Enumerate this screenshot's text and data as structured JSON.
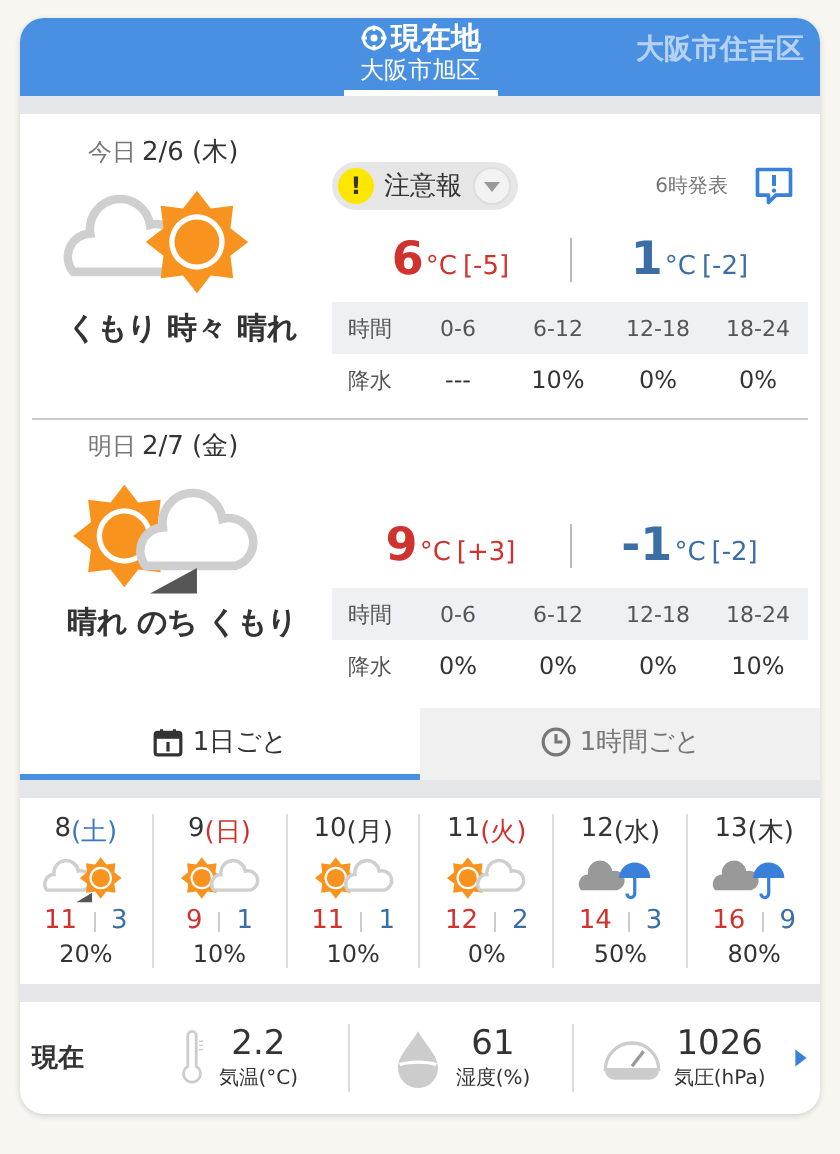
{
  "header": {
    "current": {
      "title": "現在地",
      "subtitle": "大阪市旭区",
      "selected": true
    },
    "other": {
      "title": "大阪市住吉区",
      "selected": false
    }
  },
  "days": [
    {
      "label": "今日",
      "date": "2/6 (木)",
      "kind": "cloudsun",
      "weather": "くもり 時々 晴れ",
      "high": {
        "value": "6",
        "unit": "°C",
        "diff": "[-5]"
      },
      "low": {
        "value": "1",
        "unit": "°C",
        "diff": "[-2]"
      },
      "times": [
        "時間",
        "0-6",
        "6-12",
        "12-18",
        "18-24"
      ],
      "rain": [
        "降水",
        "---",
        "10%",
        "0%",
        "0%"
      ]
    },
    {
      "label": "明日",
      "date": "2/7 (金)",
      "kind": "sunlatercloud",
      "weather": "晴れ のち くもり",
      "high": {
        "value": "9",
        "unit": "°C",
        "diff": "[+3]"
      },
      "low": {
        "value": "-1",
        "unit": "°C",
        "diff": "[-2]"
      },
      "times": [
        "時間",
        "0-6",
        "6-12",
        "12-18",
        "18-24"
      ],
      "rain": [
        "降水",
        "0%",
        "0%",
        "0%",
        "10%"
      ]
    }
  ],
  "alert": {
    "mark": "!",
    "label": "注意報",
    "issued": "6時発表"
  },
  "tabs": [
    {
      "label": "1日ごと",
      "selected": true
    },
    {
      "label": "1時間ごと",
      "selected": false
    }
  ],
  "week": [
    {
      "day": "8",
      "dow": "(土)",
      "color": "#3a78c2",
      "kind": "cloudlatersun",
      "high": "11",
      "low": "3",
      "pop": "20%"
    },
    {
      "day": "9",
      "dow": "(日)",
      "color": "#d0322d",
      "kind": "suncloud",
      "high": "9",
      "low": "1",
      "pop": "10%"
    },
    {
      "day": "10",
      "dow": "(月)",
      "color": "#333333",
      "kind": "suncloud",
      "high": "11",
      "low": "1",
      "pop": "10%"
    },
    {
      "day": "11",
      "dow": "(火)",
      "color": "#d0322d",
      "kind": "suncloud",
      "high": "12",
      "low": "2",
      "pop": "0%"
    },
    {
      "day": "12",
      "dow": "(水)",
      "color": "#333333",
      "kind": "rain",
      "high": "14",
      "low": "3",
      "pop": "50%"
    },
    {
      "day": "13",
      "dow": "(木)",
      "color": "#333333",
      "kind": "rain",
      "high": "16",
      "low": "9",
      "pop": "80%"
    }
  ],
  "now": {
    "label": "現在",
    "items": [
      {
        "kind": "thermometer",
        "value": "2.2",
        "label": "気温(°C)"
      },
      {
        "kind": "drop",
        "value": "61",
        "label": "湿度(%)"
      },
      {
        "kind": "gauge",
        "value": "1026",
        "label": "気圧(hPa)"
      }
    ]
  }
}
